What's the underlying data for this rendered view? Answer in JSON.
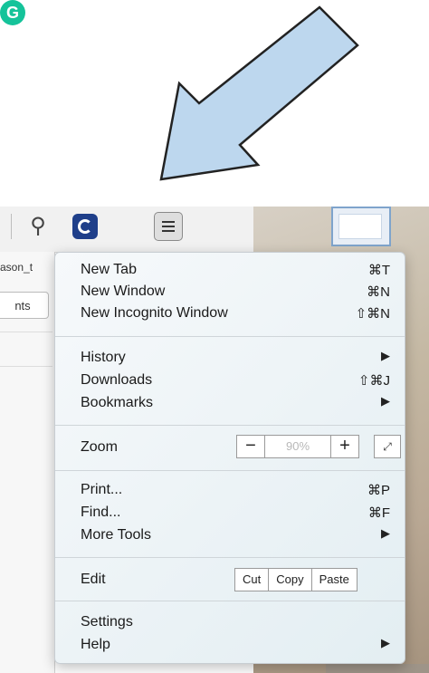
{
  "tab_fragment": "ason_t",
  "left_button": "nts",
  "menu": {
    "new_tab": {
      "label": "New Tab",
      "shortcut": "⌘T"
    },
    "new_window": {
      "label": "New Window",
      "shortcut": "⌘N"
    },
    "new_incognito": {
      "label": "New Incognito Window",
      "shortcut": "⇧⌘N"
    },
    "history": {
      "label": "History"
    },
    "downloads": {
      "label": "Downloads",
      "shortcut": "⇧⌘J"
    },
    "bookmarks": {
      "label": "Bookmarks"
    },
    "zoom": {
      "label": "Zoom",
      "minus": "−",
      "value": "90%",
      "plus": "+",
      "fullscreen": "⤢"
    },
    "print": {
      "label": "Print...",
      "shortcut": "⌘P"
    },
    "find": {
      "label": "Find...",
      "shortcut": "⌘F"
    },
    "more_tools": {
      "label": "More Tools"
    },
    "edit": {
      "label": "Edit",
      "cut": "Cut",
      "copy": "Copy",
      "paste": "Paste"
    },
    "settings": {
      "label": "Settings"
    },
    "help": {
      "label": "Help"
    },
    "submenu_arrow": "▶"
  },
  "colors": {
    "arrow_fill": "#bdd7ee",
    "grammarly": "#15c39a",
    "extension_blue": "#1f3f8a"
  }
}
